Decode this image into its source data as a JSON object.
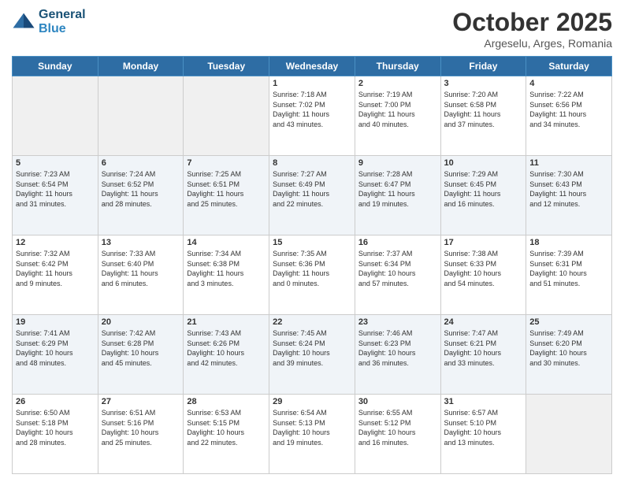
{
  "header": {
    "logo_line1": "General",
    "logo_line2": "Blue",
    "month": "October 2025",
    "location": "Argeselu, Arges, Romania"
  },
  "days_of_week": [
    "Sunday",
    "Monday",
    "Tuesday",
    "Wednesday",
    "Thursday",
    "Friday",
    "Saturday"
  ],
  "weeks": [
    [
      {
        "num": "",
        "info": ""
      },
      {
        "num": "",
        "info": ""
      },
      {
        "num": "",
        "info": ""
      },
      {
        "num": "1",
        "info": "Sunrise: 7:18 AM\nSunset: 7:02 PM\nDaylight: 11 hours\nand 43 minutes."
      },
      {
        "num": "2",
        "info": "Sunrise: 7:19 AM\nSunset: 7:00 PM\nDaylight: 11 hours\nand 40 minutes."
      },
      {
        "num": "3",
        "info": "Sunrise: 7:20 AM\nSunset: 6:58 PM\nDaylight: 11 hours\nand 37 minutes."
      },
      {
        "num": "4",
        "info": "Sunrise: 7:22 AM\nSunset: 6:56 PM\nDaylight: 11 hours\nand 34 minutes."
      }
    ],
    [
      {
        "num": "5",
        "info": "Sunrise: 7:23 AM\nSunset: 6:54 PM\nDaylight: 11 hours\nand 31 minutes."
      },
      {
        "num": "6",
        "info": "Sunrise: 7:24 AM\nSunset: 6:52 PM\nDaylight: 11 hours\nand 28 minutes."
      },
      {
        "num": "7",
        "info": "Sunrise: 7:25 AM\nSunset: 6:51 PM\nDaylight: 11 hours\nand 25 minutes."
      },
      {
        "num": "8",
        "info": "Sunrise: 7:27 AM\nSunset: 6:49 PM\nDaylight: 11 hours\nand 22 minutes."
      },
      {
        "num": "9",
        "info": "Sunrise: 7:28 AM\nSunset: 6:47 PM\nDaylight: 11 hours\nand 19 minutes."
      },
      {
        "num": "10",
        "info": "Sunrise: 7:29 AM\nSunset: 6:45 PM\nDaylight: 11 hours\nand 16 minutes."
      },
      {
        "num": "11",
        "info": "Sunrise: 7:30 AM\nSunset: 6:43 PM\nDaylight: 11 hours\nand 12 minutes."
      }
    ],
    [
      {
        "num": "12",
        "info": "Sunrise: 7:32 AM\nSunset: 6:42 PM\nDaylight: 11 hours\nand 9 minutes."
      },
      {
        "num": "13",
        "info": "Sunrise: 7:33 AM\nSunset: 6:40 PM\nDaylight: 11 hours\nand 6 minutes."
      },
      {
        "num": "14",
        "info": "Sunrise: 7:34 AM\nSunset: 6:38 PM\nDaylight: 11 hours\nand 3 minutes."
      },
      {
        "num": "15",
        "info": "Sunrise: 7:35 AM\nSunset: 6:36 PM\nDaylight: 11 hours\nand 0 minutes."
      },
      {
        "num": "16",
        "info": "Sunrise: 7:37 AM\nSunset: 6:34 PM\nDaylight: 10 hours\nand 57 minutes."
      },
      {
        "num": "17",
        "info": "Sunrise: 7:38 AM\nSunset: 6:33 PM\nDaylight: 10 hours\nand 54 minutes."
      },
      {
        "num": "18",
        "info": "Sunrise: 7:39 AM\nSunset: 6:31 PM\nDaylight: 10 hours\nand 51 minutes."
      }
    ],
    [
      {
        "num": "19",
        "info": "Sunrise: 7:41 AM\nSunset: 6:29 PM\nDaylight: 10 hours\nand 48 minutes."
      },
      {
        "num": "20",
        "info": "Sunrise: 7:42 AM\nSunset: 6:28 PM\nDaylight: 10 hours\nand 45 minutes."
      },
      {
        "num": "21",
        "info": "Sunrise: 7:43 AM\nSunset: 6:26 PM\nDaylight: 10 hours\nand 42 minutes."
      },
      {
        "num": "22",
        "info": "Sunrise: 7:45 AM\nSunset: 6:24 PM\nDaylight: 10 hours\nand 39 minutes."
      },
      {
        "num": "23",
        "info": "Sunrise: 7:46 AM\nSunset: 6:23 PM\nDaylight: 10 hours\nand 36 minutes."
      },
      {
        "num": "24",
        "info": "Sunrise: 7:47 AM\nSunset: 6:21 PM\nDaylight: 10 hours\nand 33 minutes."
      },
      {
        "num": "25",
        "info": "Sunrise: 7:49 AM\nSunset: 6:20 PM\nDaylight: 10 hours\nand 30 minutes."
      }
    ],
    [
      {
        "num": "26",
        "info": "Sunrise: 6:50 AM\nSunset: 5:18 PM\nDaylight: 10 hours\nand 28 minutes."
      },
      {
        "num": "27",
        "info": "Sunrise: 6:51 AM\nSunset: 5:16 PM\nDaylight: 10 hours\nand 25 minutes."
      },
      {
        "num": "28",
        "info": "Sunrise: 6:53 AM\nSunset: 5:15 PM\nDaylight: 10 hours\nand 22 minutes."
      },
      {
        "num": "29",
        "info": "Sunrise: 6:54 AM\nSunset: 5:13 PM\nDaylight: 10 hours\nand 19 minutes."
      },
      {
        "num": "30",
        "info": "Sunrise: 6:55 AM\nSunset: 5:12 PM\nDaylight: 10 hours\nand 16 minutes."
      },
      {
        "num": "31",
        "info": "Sunrise: 6:57 AM\nSunset: 5:10 PM\nDaylight: 10 hours\nand 13 minutes."
      },
      {
        "num": "",
        "info": ""
      }
    ]
  ]
}
